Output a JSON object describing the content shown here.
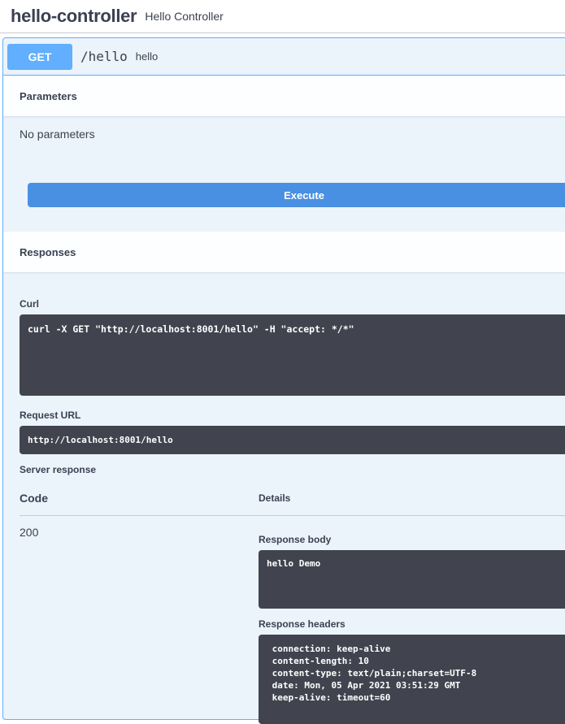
{
  "tag": {
    "name": "hello-controller",
    "description": "Hello Controller"
  },
  "operation": {
    "method": "GET",
    "path": "/hello",
    "summary": "hello"
  },
  "parameters": {
    "title": "Parameters",
    "empty_text": "No parameters"
  },
  "execute_label": "Execute",
  "responses": {
    "title": "Responses",
    "curl_label": "Curl",
    "curl": "curl -X GET \"http://localhost:8001/hello\" -H \"accept: */*\"",
    "request_url_label": "Request URL",
    "request_url": "http://localhost:8001/hello",
    "server_response_label": "Server response",
    "code_header": "Code",
    "details_header": "Details",
    "code": "200",
    "body_label": "Response body",
    "body": "hello Demo",
    "headers_label": "Response headers",
    "headers": " connection: keep-alive\n content-length: 10\n content-type: text/plain;charset=UTF-8\n date: Mon, 05 Apr 2021 03:51:29 GMT\n keep-alive: timeout=60"
  },
  "colors": {
    "get_accent": "#61affe",
    "execute": "#4990e2",
    "code_bg": "#41444e",
    "text": "#3b4151"
  }
}
